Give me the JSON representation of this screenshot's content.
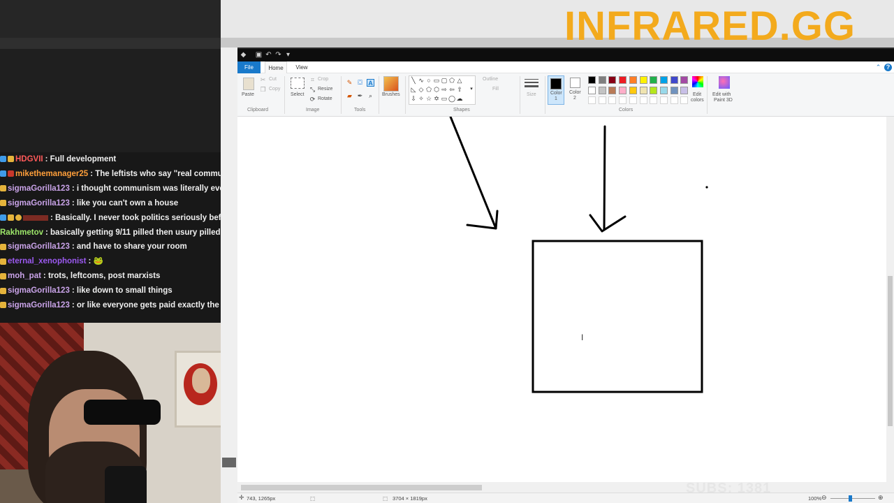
{
  "overlay": {
    "brand": "INFRARED.GG",
    "subs_counter": "SUBS: 1381"
  },
  "chat": {
    "messages": [
      {
        "user": "HDGVII",
        "color": "#ff5a5a",
        "badges": [
          "blue",
          "gold"
        ],
        "text": ": Full development"
      },
      {
        "user": "mikethemanager25",
        "color": "#ff9f3a",
        "badges": [
          "blue",
          "red"
        ],
        "text": ": The leftists who say \"real communis"
      },
      {
        "user": "sigmaGorilla123",
        "color": "#c9a3e8",
        "badges": [
          "gold"
        ],
        "text": ": i thought communism was literally everyo"
      },
      {
        "user": "sigmaGorilla123",
        "color": "#c9a3e8",
        "badges": [
          "gold"
        ],
        "text": ": like you can't own a house"
      },
      {
        "user": "",
        "color": "#c0392b",
        "badges": [
          "blue",
          "gold",
          "circ"
        ],
        "text": ": Basically. I never took politics seriously before"
      },
      {
        "user": "Rakhmetov",
        "color": "#9ee86a",
        "badges": [],
        "text": ": basically getting 9/11 pilled then usury pilled had"
      },
      {
        "user": "sigmaGorilla123",
        "color": "#c9a3e8",
        "badges": [
          "gold"
        ],
        "text": ": and have to share your room"
      },
      {
        "user": "eternal_xenophonist",
        "color": "#9b59f0",
        "badges": [
          "gold"
        ],
        "text": ":"
      },
      {
        "user": "moh_pat",
        "color": "#c9a3e8",
        "badges": [
          "gold"
        ],
        "text": ": trots, leftcoms, post marxists"
      },
      {
        "user": "sigmaGorilla123",
        "color": "#c9a3e8",
        "badges": [
          "gold"
        ],
        "text": ": like down to small things"
      },
      {
        "user": "sigmaGorilla123",
        "color": "#c9a3e8",
        "badges": [
          "gold"
        ],
        "text": ": or like everyone gets paid exactly the sam"
      }
    ]
  },
  "paint": {
    "menu": {
      "file": "File",
      "home": "Home",
      "view": "View"
    },
    "clipboard": {
      "paste": "Paste",
      "cut": "Cut",
      "copy": "Copy",
      "group": "Clipboard"
    },
    "image": {
      "select": "Select",
      "crop": "Crop",
      "resize": "Resize",
      "rotate": "Rotate",
      "group": "Image"
    },
    "tools": {
      "group": "Tools"
    },
    "brushes": {
      "label": "Brushes"
    },
    "shapes": {
      "outline": "Outline",
      "fill": "Fill",
      "group": "Shapes"
    },
    "size": {
      "label": "Size"
    },
    "colors": {
      "color1": "Color\n1",
      "color1_a": "Color",
      "color1_b": "1",
      "color2_a": "Color",
      "color2_b": "2",
      "edit_a": "Edit",
      "edit_b": "colors",
      "group": "Colors",
      "palette_row1": [
        "#000000",
        "#7f7f7f",
        "#880015",
        "#ed1c24",
        "#ff7f27",
        "#fff200",
        "#22b14c",
        "#00a2e8",
        "#3f48cc",
        "#a349a4"
      ],
      "palette_row2": [
        "#ffffff",
        "#c3c3c3",
        "#b97a57",
        "#ffaec9",
        "#ffc90e",
        "#efe4b0",
        "#b5e61d",
        "#99d9ea",
        "#7092be",
        "#c8bfe7"
      ],
      "color1_value": "#000000",
      "color2_value": "#ffffff"
    },
    "paint3d": {
      "line1": "Edit with",
      "line2": "Paint 3D"
    },
    "status": {
      "cursor_pos": "743, 1265px",
      "image_size": "3704 × 1819px",
      "zoom": "100%"
    }
  }
}
